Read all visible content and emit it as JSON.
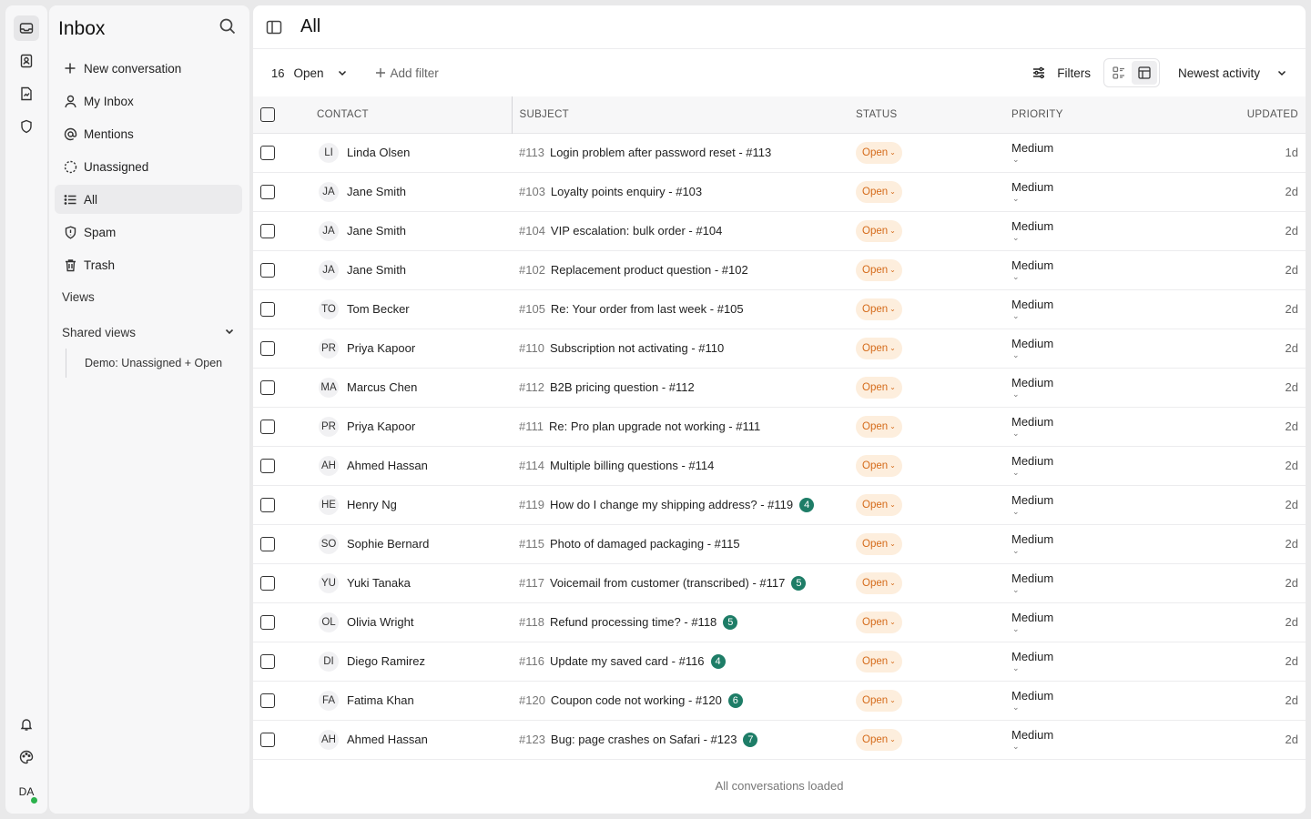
{
  "rail": {
    "icons": [
      "inbox-icon",
      "contacts-icon",
      "reports-icon",
      "shield-icon"
    ],
    "bottom_icons": [
      "bell-icon",
      "palette-icon"
    ],
    "avatar_initials": "DA",
    "online_color": "#2bb24c"
  },
  "sidebar": {
    "title": "Inbox",
    "items": [
      {
        "label": "New conversation",
        "icon": "plus-icon"
      },
      {
        "label": "My Inbox",
        "icon": "user-icon"
      },
      {
        "label": "Mentions",
        "icon": "at-icon"
      },
      {
        "label": "Unassigned",
        "icon": "dashed-circle-icon"
      },
      {
        "label": "All",
        "icon": "list-icon",
        "active": true
      },
      {
        "label": "Spam",
        "icon": "shield-alert-icon"
      },
      {
        "label": "Trash",
        "icon": "trash-icon"
      }
    ],
    "views_label": "Views",
    "shared_views_label": "Shared views",
    "shared_views": [
      "Demo: Unassigned + Open"
    ]
  },
  "header": {
    "title": "All"
  },
  "toolbar": {
    "count": "16",
    "status_filter": "Open",
    "add_filter_label": "Add filter",
    "filters_label": "Filters",
    "sort_label": "Newest activity"
  },
  "table": {
    "columns": {
      "contact": "CONTACT",
      "subject": "SUBJECT",
      "status": "STATUS",
      "priority": "PRIORITY",
      "updated": "UPDATED"
    },
    "rows": [
      {
        "initials": "LI",
        "name": "Linda Olsen",
        "id": "#113",
        "subject": "Login problem after password reset - #113",
        "badge": "",
        "status": "Open",
        "priority": "Medium",
        "updated": "1d"
      },
      {
        "initials": "JA",
        "name": "Jane Smith",
        "id": "#103",
        "subject": "Loyalty points enquiry - #103",
        "badge": "",
        "status": "Open",
        "priority": "Medium",
        "updated": "2d"
      },
      {
        "initials": "JA",
        "name": "Jane Smith",
        "id": "#104",
        "subject": "VIP escalation: bulk order - #104",
        "badge": "",
        "status": "Open",
        "priority": "Medium",
        "updated": "2d"
      },
      {
        "initials": "JA",
        "name": "Jane Smith",
        "id": "#102",
        "subject": "Replacement product question - #102",
        "badge": "",
        "status": "Open",
        "priority": "Medium",
        "updated": "2d"
      },
      {
        "initials": "TO",
        "name": "Tom Becker",
        "id": "#105",
        "subject": "Re: Your order from last week - #105",
        "badge": "",
        "status": "Open",
        "priority": "Medium",
        "updated": "2d"
      },
      {
        "initials": "PR",
        "name": "Priya Kapoor",
        "id": "#110",
        "subject": "Subscription not activating - #110",
        "badge": "",
        "status": "Open",
        "priority": "Medium",
        "updated": "2d"
      },
      {
        "initials": "MA",
        "name": "Marcus Chen",
        "id": "#112",
        "subject": "B2B pricing question - #112",
        "badge": "",
        "status": "Open",
        "priority": "Medium",
        "updated": "2d"
      },
      {
        "initials": "PR",
        "name": "Priya Kapoor",
        "id": "#111",
        "subject": "Re: Pro plan upgrade not working - #111",
        "badge": "",
        "status": "Open",
        "priority": "Medium",
        "updated": "2d"
      },
      {
        "initials": "AH",
        "name": "Ahmed Hassan",
        "id": "#114",
        "subject": "Multiple billing questions - #114",
        "badge": "",
        "status": "Open",
        "priority": "Medium",
        "updated": "2d"
      },
      {
        "initials": "HE",
        "name": "Henry Ng",
        "id": "#119",
        "subject": "How do I change my shipping address? - #119",
        "badge": "4",
        "status": "Open",
        "priority": "Medium",
        "updated": "2d"
      },
      {
        "initials": "SO",
        "name": "Sophie Bernard",
        "id": "#115",
        "subject": "Photo of damaged packaging - #115",
        "badge": "",
        "status": "Open",
        "priority": "Medium",
        "updated": "2d"
      },
      {
        "initials": "YU",
        "name": "Yuki Tanaka",
        "id": "#117",
        "subject": "Voicemail from customer (transcribed) - #117",
        "badge": "5",
        "status": "Open",
        "priority": "Medium",
        "updated": "2d"
      },
      {
        "initials": "OL",
        "name": "Olivia Wright",
        "id": "#118",
        "subject": "Refund processing time? - #118",
        "badge": "5",
        "status": "Open",
        "priority": "Medium",
        "updated": "2d"
      },
      {
        "initials": "DI",
        "name": "Diego Ramirez",
        "id": "#116",
        "subject": "Update my saved card - #116",
        "badge": "4",
        "status": "Open",
        "priority": "Medium",
        "updated": "2d"
      },
      {
        "initials": "FA",
        "name": "Fatima Khan",
        "id": "#120",
        "subject": "Coupon code not working - #120",
        "badge": "6",
        "status": "Open",
        "priority": "Medium",
        "updated": "2d"
      },
      {
        "initials": "AH",
        "name": "Ahmed Hassan",
        "id": "#123",
        "subject": "Bug: page crashes on Safari - #123",
        "badge": "7",
        "status": "Open",
        "priority": "Medium",
        "updated": "2d"
      }
    ],
    "footer": "All conversations loaded"
  },
  "colors": {
    "status_bg": "#fdeedd",
    "status_text": "#d56b1a",
    "badge": "#1e7d67"
  }
}
